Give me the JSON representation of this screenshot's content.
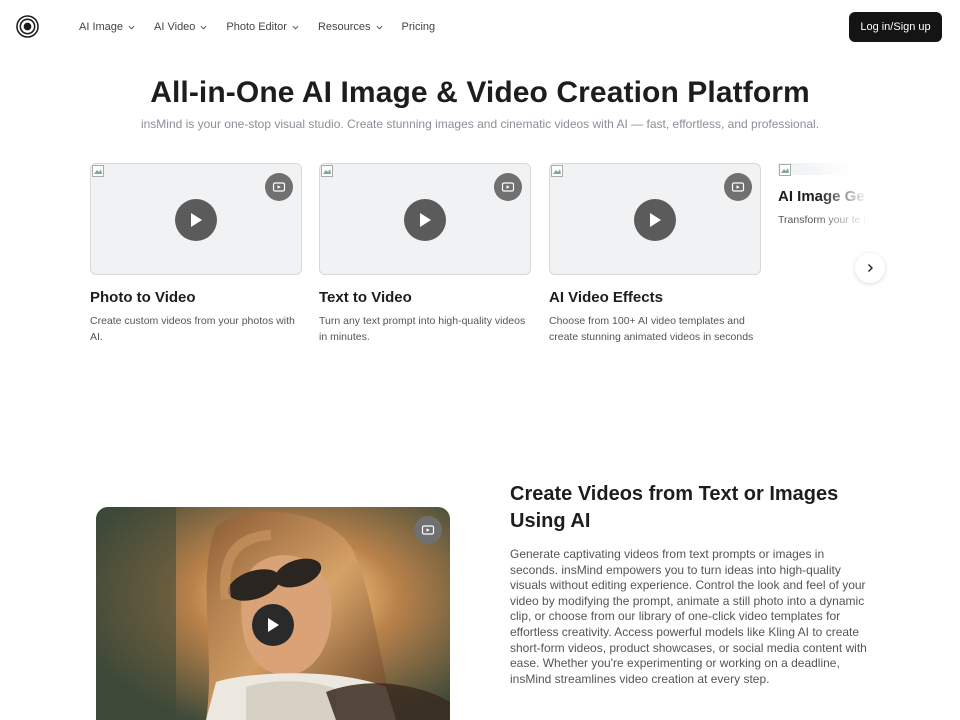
{
  "nav": {
    "logo_icon": "insmind-logo-icon",
    "items": [
      {
        "label": "AI Image",
        "has_dropdown": true
      },
      {
        "label": "AI Video",
        "has_dropdown": true
      },
      {
        "label": "Photo Editor",
        "has_dropdown": true
      },
      {
        "label": "Resources",
        "has_dropdown": true
      },
      {
        "label": "Pricing",
        "has_dropdown": false
      }
    ],
    "login_label": "Log in/Sign up"
  },
  "hero": {
    "title": "All-in-One AI Image & Video Creation Platform",
    "subtitle": "insMind is your one-stop visual studio. Create stunning images and cinematic videos with AI — fast, effortless, and professional."
  },
  "cards": [
    {
      "title": "Photo to Video",
      "desc": "Create custom videos from your photos with AI."
    },
    {
      "title": "Text to Video",
      "desc": "Turn any text prompt into high-quality videos in minutes."
    },
    {
      "title": "AI Video Effects",
      "desc": "Choose from 100+ AI video templates and create stunning animated videos in seconds"
    },
    {
      "title": "AI Image Ge",
      "desc": "Transform your te just a simple prom"
    }
  ],
  "feature": {
    "title": "Create Videos from Text or Images Using AI",
    "body": "Generate captivating videos from text prompts or images in seconds. insMind empowers you to turn ideas into high-quality visuals without editing experience. Control the look and feel of your video by modifying the prompt, animate a still photo into a dynamic clip, or choose from our library of one-click video templates for effortless creativity. Access powerful models like Kling AI to create short-form videos, product showcases, or social media content with ease. Whether you're experimenting or working on a deadline, insMind streamlines video creation at every step."
  },
  "colors": {
    "login_bg": "#141414",
    "play_button": "#5b5b5b",
    "badge": "#707070"
  }
}
